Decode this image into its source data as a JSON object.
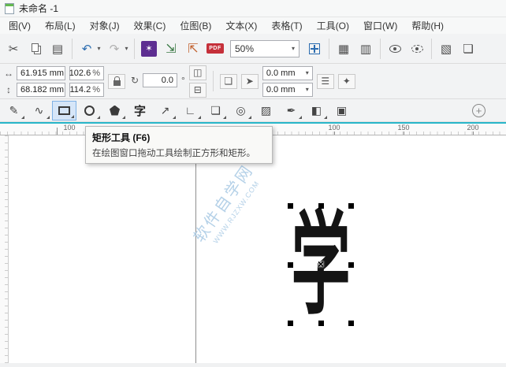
{
  "ui": {
    "caret": "▾"
  },
  "window": {
    "title": "未命名 -1"
  },
  "menubar": {
    "items": [
      "图(V)",
      "布局(L)",
      "对象(J)",
      "效果(C)",
      "位图(B)",
      "文本(X)",
      "表格(T)",
      "工具(O)",
      "窗口(W)",
      "帮助(H)"
    ]
  },
  "toolbar": {
    "zoom_value": "50%",
    "icons": {
      "cut": "✂",
      "copy": "double-page",
      "paste": "▤",
      "undo": "↶",
      "redo": "↷",
      "welcome_screen": "✶",
      "import": "⇲",
      "export": "⇱",
      "pdf": "PDF",
      "show_rulers": "▦",
      "show_grid": "▥",
      "extra_a": "▧",
      "extra_b": "❏"
    }
  },
  "property_bar": {
    "object_width": "61.915 mm",
    "object_height": "68.182 mm",
    "scale_h": "102.6",
    "scale_v": "114.2",
    "percent": "%",
    "rotation_angle": "0.0",
    "degree": "°",
    "outline_width_top": "0.0 mm",
    "outline_width_bottom": "0.0 mm",
    "icons": {
      "width": "↔",
      "height": "↕",
      "rotate": "↻",
      "mirror_h": "◫",
      "mirror_v": "⊟",
      "to_front": "❏",
      "pick": "➤",
      "options": "☰",
      "effects": "✦"
    }
  },
  "toolbox": {
    "text_tool_label": "字",
    "icons": {
      "freehand": "✎",
      "artistic_media": "∿",
      "dimension": "↗",
      "connector": "∟",
      "drop_shadow": "❏",
      "contour": "◎",
      "transparency": "▨",
      "eyedropper": "✒",
      "interactive_fill": "◧",
      "smart_fill": "▣",
      "add_tools": "+"
    }
  },
  "tooltip": {
    "title": "矩形工具 (F6)",
    "body": "在绘图窗口拖动工具绘制正方形和矩形。"
  },
  "ruler": {
    "labels": [
      "100",
      "100",
      "150",
      "200"
    ]
  },
  "canvas": {
    "watermark_line1": "软件自学网",
    "watermark_line2": "WWW.RJZXW.COM",
    "selected_object_text": "学",
    "center_marker": "×"
  }
}
